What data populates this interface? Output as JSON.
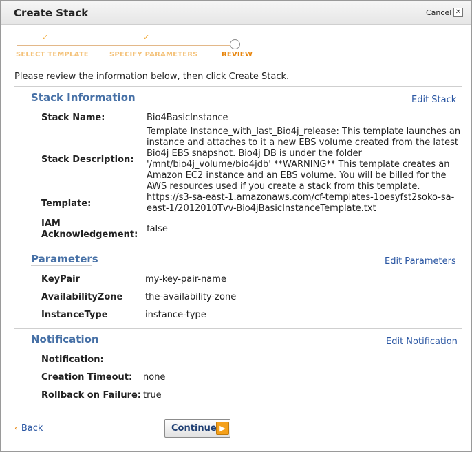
{
  "window": {
    "title": "Create Stack",
    "cancel_label": "Cancel",
    "close_glyph": "✕"
  },
  "wizard": {
    "steps": [
      {
        "label": "SELECT TEMPLATE",
        "check": "✓"
      },
      {
        "label": "SPECIFY PARAMETERS",
        "check": "✓"
      },
      {
        "label": "REVIEW"
      }
    ]
  },
  "intro": "Please review the information below, then click Create Stack.",
  "stack_info": {
    "title": "Stack Information",
    "edit_label": "Edit Stack",
    "name_label": "Stack Name:",
    "name_value": "Bio4BasicInstance",
    "description_label": "Stack Description:",
    "description_value": "Template Instance_with_last_Bio4j_release: This template launches an instance and attaches to it a new EBS volume created from the latest Bio4j EBS snapshot. Bio4j DB is under the folder '/mnt/bio4j_volume/bio4jdb' **WARNING** This template creates an Amazon EC2 instance and an EBS volume. You will be billed for the AWS resources used if you create a stack from this template.",
    "template_label": "Template:",
    "template_value": "https://s3-sa-east-1.amazonaws.com/cf-templates-1oesyfst2soko-sa-east-1/2012010Tvv-Bio4jBasicInstanceTemplate.txt",
    "iam_label_1": "IAM",
    "iam_label_2": "Acknowledgement:",
    "iam_value": "false"
  },
  "parameters": {
    "title": "Parameters",
    "edit_label": "Edit Parameters",
    "rows": [
      {
        "label": "KeyPair",
        "value": "my-key-pair-name"
      },
      {
        "label": "AvailabilityZone",
        "value": "the-availability-zone"
      },
      {
        "label": "InstanceType",
        "value": "instance-type"
      }
    ]
  },
  "notification": {
    "title": "Notification",
    "edit_label": "Edit Notification",
    "notification_label": "Notification:",
    "notification_value": "",
    "timeout_label": "Creation Timeout:",
    "timeout_value": "none",
    "rollback_label": "Rollback on Failure:",
    "rollback_value": "true"
  },
  "footer": {
    "back_glyph": "‹",
    "back_label": "Back",
    "continue_label": "Continue",
    "continue_arrow": "▶"
  },
  "colors": {
    "accent_orange": "#f4a01a",
    "section_blue": "#4670a6",
    "link_blue": "#2b57a3"
  }
}
